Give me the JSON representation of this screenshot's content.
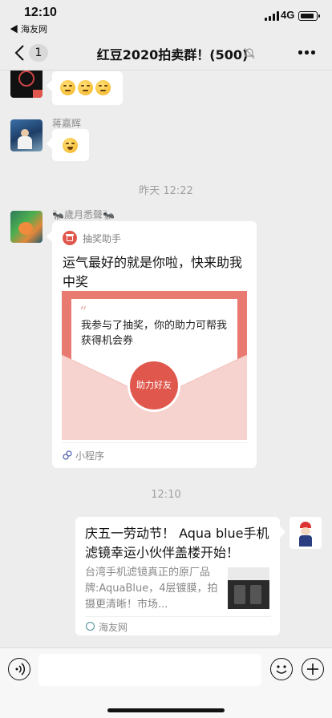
{
  "status_bar": {
    "time": "12:10",
    "back_app": "◀ 海友网",
    "network": "4G"
  },
  "nav": {
    "unread_count": "1",
    "title": "红豆2020拍卖群！(500)"
  },
  "messages": {
    "msg1": {
      "emoji_count": 3
    },
    "msg2": {
      "sender": "蒋嘉辉"
    },
    "time1": "昨天 12:22",
    "msg3": {
      "sender": "🐜歲月悉聲🐜",
      "app_name": "抽奖助手",
      "text": "运气最好的就是你啦，快来助我中奖",
      "letter_text": "我参与了抽奖，你的助力可帮我获得机会券",
      "button_label": "助力好友",
      "footer": "小程序"
    },
    "time2": "12:10",
    "msg4": {
      "title": "庆五一劳动节！ Aqua blue手机滤镜幸运小伙伴盖楼开始！",
      "description": "台湾手机滤镜真正的原厂品牌:AquaBlue，4层镀膜，拍摄更清晰！市场...",
      "source": "海友网"
    }
  },
  "input": {
    "placeholder": ""
  },
  "colors": {
    "brand_red": "#e0574d",
    "background": "#ededed"
  }
}
